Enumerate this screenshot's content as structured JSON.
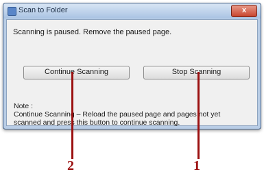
{
  "window": {
    "title": "Scan to Folder",
    "close_label": "x"
  },
  "dialog": {
    "message": "Scanning is paused. Remove the paused page.",
    "continue_button": "Continue Scanning",
    "stop_button": "Stop Scanning",
    "note_label": "Note :",
    "note_line1": "Continue Scanning – Reload the paused page and pages not yet",
    "note_line2": "scanned and press this button to continue scanning."
  },
  "callouts": {
    "stop_number": "1",
    "continue_number": "2",
    "color": "#9b1010"
  }
}
